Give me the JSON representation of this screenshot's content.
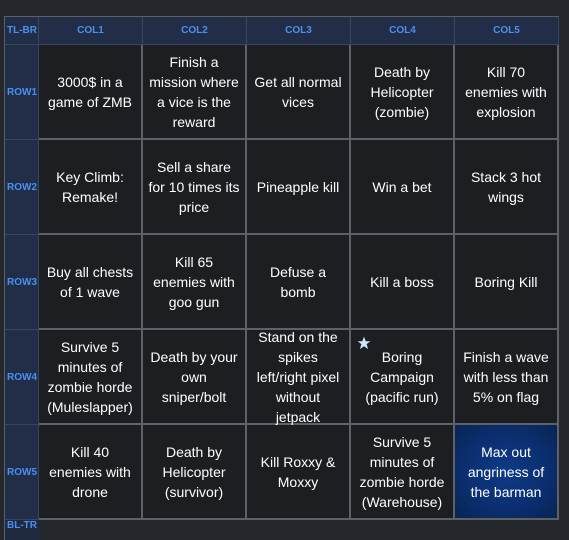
{
  "corner_label": "TL-BR",
  "columns": [
    "COL1",
    "COL2",
    "COL3",
    "COL4",
    "COL5"
  ],
  "rows": [
    {
      "label": "ROW1",
      "cells": [
        {
          "text": "3000$ in a game of ZMB"
        },
        {
          "text": "Finish a mission where a vice is the reward"
        },
        {
          "text": "Get all normal vices"
        },
        {
          "text": "Death by Helicopter (zombie)"
        },
        {
          "text": "Kill 70 enemies with explosion"
        }
      ]
    },
    {
      "label": "ROW2",
      "cells": [
        {
          "text": "Key Climb: Remake!"
        },
        {
          "text": "Sell a share for 10 times its price"
        },
        {
          "text": "Pineapple kill"
        },
        {
          "text": "Win a bet"
        },
        {
          "text": "Stack 3 hot wings"
        }
      ]
    },
    {
      "label": "ROW3",
      "cells": [
        {
          "text": "Buy all chests of 1 wave"
        },
        {
          "text": "Kill 65 enemies with goo gun"
        },
        {
          "text": "Defuse a bomb"
        },
        {
          "text": "Kill a boss"
        },
        {
          "text": "Boring Kill"
        }
      ]
    },
    {
      "label": "ROW4",
      "cells": [
        {
          "text": "Survive 5 minutes of zombie horde (Muleslapper)"
        },
        {
          "text": "Death by your own sniper/bolt"
        },
        {
          "text": "Stand on the spikes left/right pixel without jetpack"
        },
        {
          "text": "Boring Campaign (pacific run)",
          "starred": true,
          "icon": "star-icon"
        },
        {
          "text": "Finish a wave with less than 5% on flag"
        }
      ]
    },
    {
      "label": "ROW5",
      "cells": [
        {
          "text": "Kill 40 enemies with drone"
        },
        {
          "text": "Death by Helicopter (survivor)"
        },
        {
          "text": "Kill Roxxy & Moxxy"
        },
        {
          "text": "Survive 5 minutes of zombie horde (Warehouse)"
        },
        {
          "text": "Max out angriness of the barman",
          "selected": true
        }
      ]
    }
  ],
  "footer_label": "BL-TR",
  "colors": {
    "header_bg": "#222e48",
    "header_text": "#4b8ff0",
    "cell_bg": "#1d1e21",
    "cell_text": "#ffffff",
    "selected_bg": "#0b2f71",
    "star": "#cfe8f5"
  }
}
